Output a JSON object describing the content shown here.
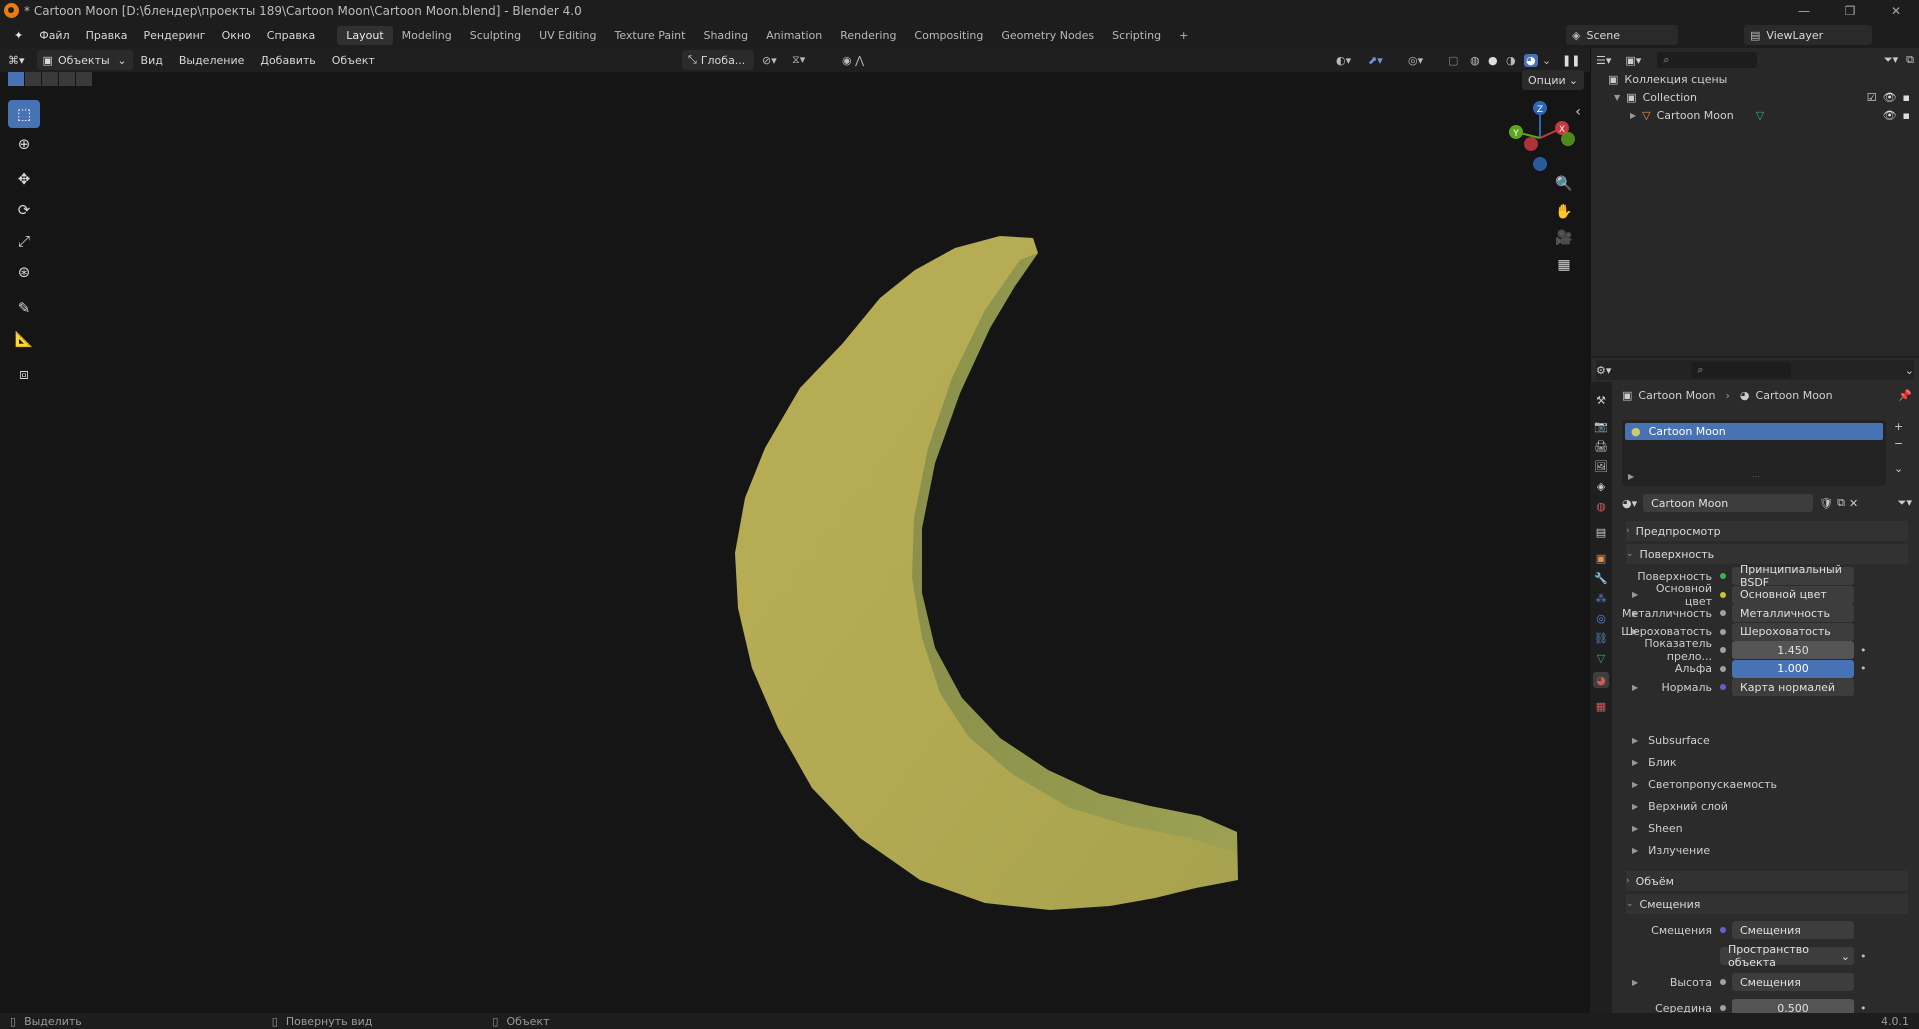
{
  "window": {
    "title": "* Cartoon Moon [D:\\блендер\\проекты 189\\Cartoon Moon\\Cartoon Moon.blend] - Blender 4.0",
    "controls": [
      "—",
      "❐",
      "✕"
    ]
  },
  "menu": [
    "Файл",
    "Правка",
    "Рендеринг",
    "Окно",
    "Справка"
  ],
  "workspaces": [
    "Layout",
    "Modeling",
    "Sculpting",
    "UV Editing",
    "Texture Paint",
    "Shading",
    "Animation",
    "Rendering",
    "Compositing",
    "Geometry Nodes",
    "Scripting"
  ],
  "workspace_add": "+",
  "scene": {
    "name": "Scene",
    "viewlayer": "ViewLayer"
  },
  "viewport_header": {
    "mode": "Объекты",
    "menus": [
      "Вид",
      "Выделение",
      "Добавить",
      "Объект"
    ],
    "transform_orientation": "Глоба...",
    "options": "Опции"
  },
  "gizmo": {
    "z": "Z",
    "y": "Y",
    "x": "X"
  },
  "outliner": {
    "scene_collection": "Коллекция сцены",
    "collection": "Collection",
    "object": "Cartoon Moon"
  },
  "properties": {
    "breadcrumb_object": "Cartoon Moon",
    "breadcrumb_material": "Cartoon Moon",
    "slot": "Cartoon Moon",
    "material_name": "Cartoon Moon",
    "panels": {
      "preview": "Предпросмотр",
      "surface": "Поверхность",
      "volume": "Объём",
      "displacement": "Смещения"
    },
    "surface_rows": [
      {
        "label": "Поверхность",
        "value": "Принципиальный BSDF",
        "dot": "#3fb24f"
      },
      {
        "label": "Основной цвет",
        "value": "Основной цвет",
        "dot": "#c7c729"
      },
      {
        "label": "Металличность",
        "value": "Металличность",
        "dot": "#a1a1a1"
      },
      {
        "label": "Шероховатость",
        "value": "Шероховатость",
        "dot": "#a1a1a1"
      },
      {
        "label": "Показатель прело...",
        "value": "1.450",
        "dot": "#a1a1a1"
      },
      {
        "label": "Альфа",
        "value": "1.000",
        "dot": "#a1a1a1"
      },
      {
        "label": "Нормаль",
        "value": "Карта нормалей",
        "dot": "#6363c7"
      }
    ],
    "subpanels": [
      "Subsurface",
      "Блик",
      "Светопропускаемость",
      "Верхний слой",
      "Sheen",
      "Излучение"
    ],
    "displacement_rows": [
      {
        "label": "Смещения",
        "value": "Смещения",
        "dot": "#6363c7"
      },
      {
        "label": "",
        "value": "Пространство объекта",
        "dot": ""
      },
      {
        "label": "Высота",
        "value": "Смещения",
        "dot": "#a1a1a1"
      },
      {
        "label": "Середина",
        "value": "0.500",
        "dot": "#a1a1a1"
      }
    ]
  },
  "status": {
    "select": "Выделить",
    "rotate": "Повернуть вид",
    "object": "Объект",
    "version": "4.0.1"
  },
  "colors": {
    "accent": "#4772b3",
    "moon": "#b5ab52",
    "moon_shadow": "#7f8a47"
  }
}
